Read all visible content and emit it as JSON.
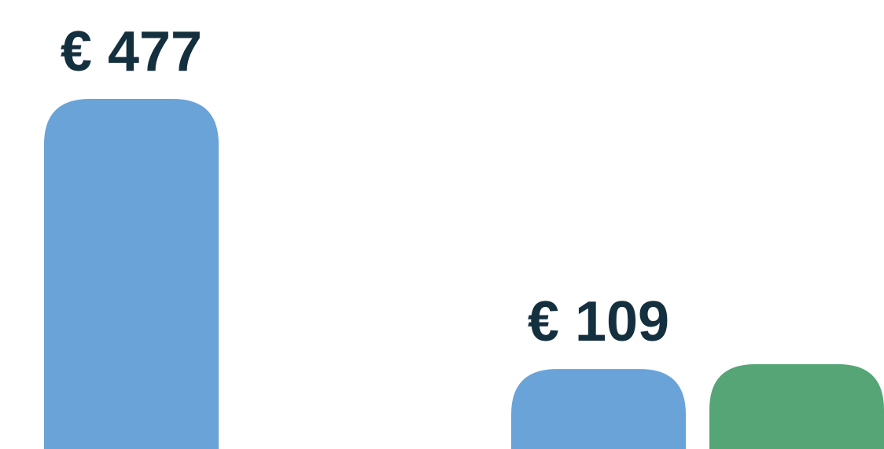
{
  "chart_data": {
    "type": "bar",
    "title": "",
    "xlabel": "",
    "ylabel": "",
    "categories": [
      "",
      "",
      "",
      ""
    ],
    "bars": [
      {
        "value": 477,
        "label": "€ 477",
        "color": "#6aa3d8"
      },
      {
        "value": null,
        "label": "",
        "color": null
      },
      {
        "value": 109,
        "label": "€ 109",
        "color": "#6aa3d8"
      },
      {
        "value": null,
        "label": "",
        "color": "#55a577"
      }
    ],
    "grid": false,
    "legend": "none"
  },
  "colors": {
    "bar_blue": "#6aa3d8",
    "bar_green": "#55a577",
    "label_text": "#14303f",
    "background": "#ffffff"
  }
}
